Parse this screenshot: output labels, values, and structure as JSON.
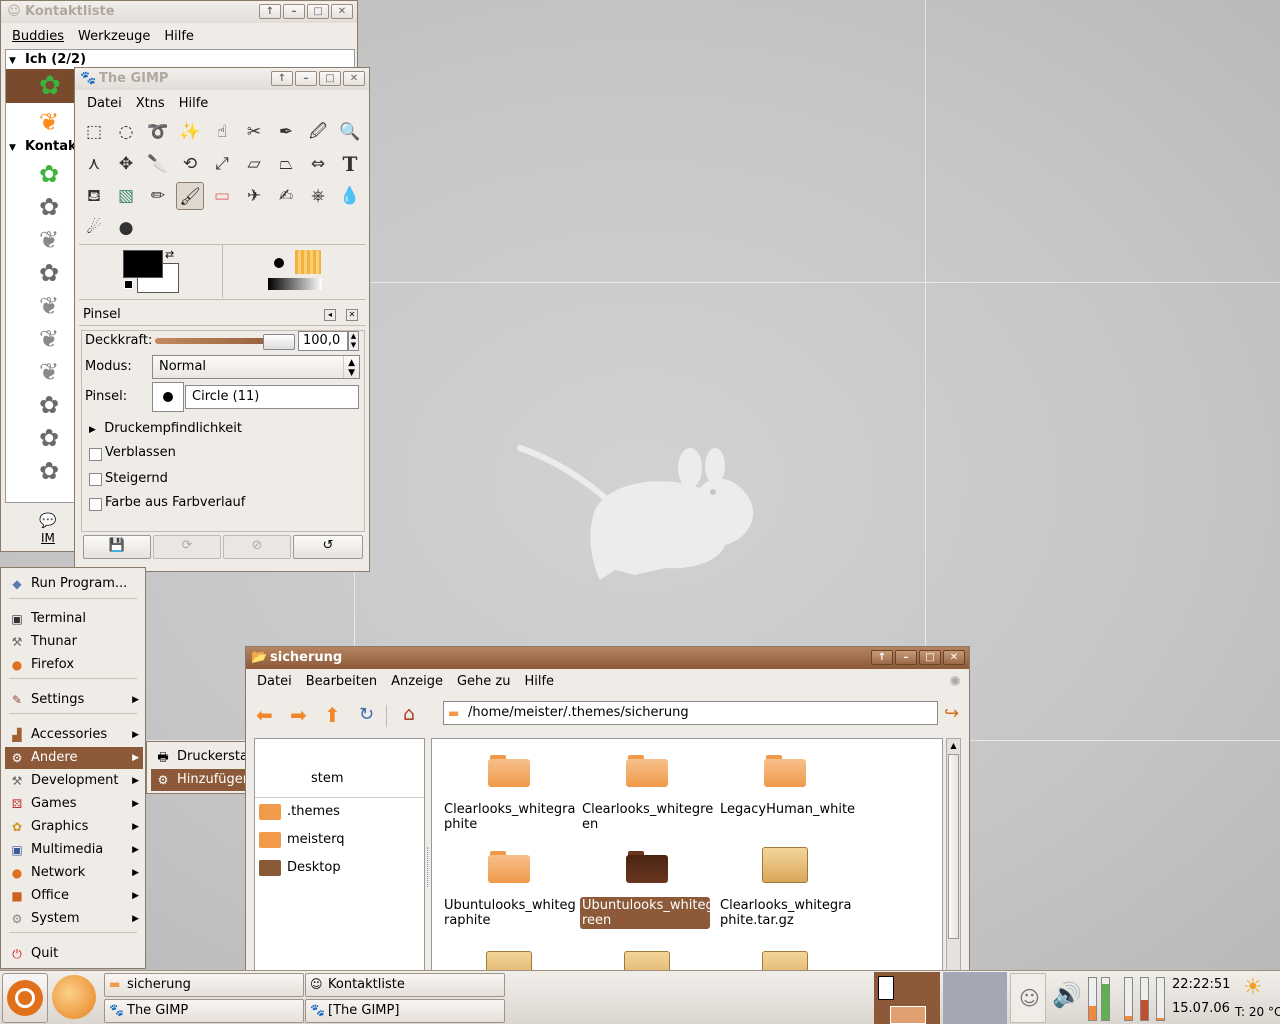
{
  "colors": {
    "accent": "#8c5a38",
    "folder": "#f09a4a",
    "desktop": "#c6c6c6"
  },
  "buddy_list": {
    "title": "Kontaktliste",
    "menu": [
      "Buddies",
      "Werkzeuge",
      "Hilfe"
    ],
    "group_me": "Ich (2/2)",
    "group_contacts": "Kontak",
    "im_label": "IM"
  },
  "gimp": {
    "title": "The GIMP",
    "menu": [
      "Datei",
      "Xtns",
      "Hilfe"
    ],
    "panel_title": "Pinsel",
    "opacity_label": "Deckkraft:",
    "opacity_value": "100,0",
    "mode_label": "Modus:",
    "mode_value": "Normal",
    "brush_label": "Pinsel:",
    "brush_value": "Circle (11)",
    "pressure_label": "Druckempfindlichkeit",
    "options": [
      "Verblassen",
      "Steigernd",
      "Farbe aus Farbverlauf"
    ]
  },
  "app_menu": {
    "items": [
      "Run Program...",
      "Terminal",
      "Thunar",
      "Firefox",
      "Settings",
      "Accessories",
      "Andere",
      "Development",
      "Games",
      "Graphics",
      "Multimedia",
      "Network",
      "Office",
      "System",
      "Quit"
    ],
    "submenu": [
      "Druckerstatus-Icon",
      "Hinzufügen/Entfernen..."
    ]
  },
  "file_manager": {
    "title": "sicherung",
    "menu": [
      "Datei",
      "Bearbeiten",
      "Anzeige",
      "Gehe zu",
      "Hilfe"
    ],
    "path": "/home/meister/.themes/sicherung",
    "sidebar": [
      ".themes",
      "meisterq",
      "Desktop"
    ],
    "sidebar_partial": "stem",
    "files": [
      {
        "name": "Clearlooks_whitegraphite",
        "kind": "folder"
      },
      {
        "name": "Clearlooks_whitegreen",
        "kind": "folder"
      },
      {
        "name": "LegacyHuman_white",
        "kind": "folder"
      },
      {
        "name": "Ubuntulooks_whitegraphite",
        "kind": "folder"
      },
      {
        "name": "Ubuntulooks_whitegreen",
        "kind": "folder-selected"
      },
      {
        "name": "Clearlooks_whitegraphite.tar.gz",
        "kind": "archive"
      }
    ],
    "file_lines": [
      [
        "Clearlooks_whitegra",
        "phite"
      ],
      [
        "Clearlooks_whitegre",
        "en"
      ],
      [
        "LegacyHuman_white",
        ""
      ],
      [
        "Ubuntulooks_whiteg",
        "raphite"
      ],
      [
        "Ubuntulooks_whiteg",
        "reen"
      ],
      [
        "Clearlooks_whitegra",
        "phite.tar.gz"
      ]
    ]
  },
  "taskbar": {
    "tasks": [
      "sicherung",
      "Kontaktliste",
      "The GIMP",
      "[The GIMP]"
    ],
    "time": "22:22:51",
    "date": "15.07.06",
    "temp": "T: 20 °C"
  }
}
